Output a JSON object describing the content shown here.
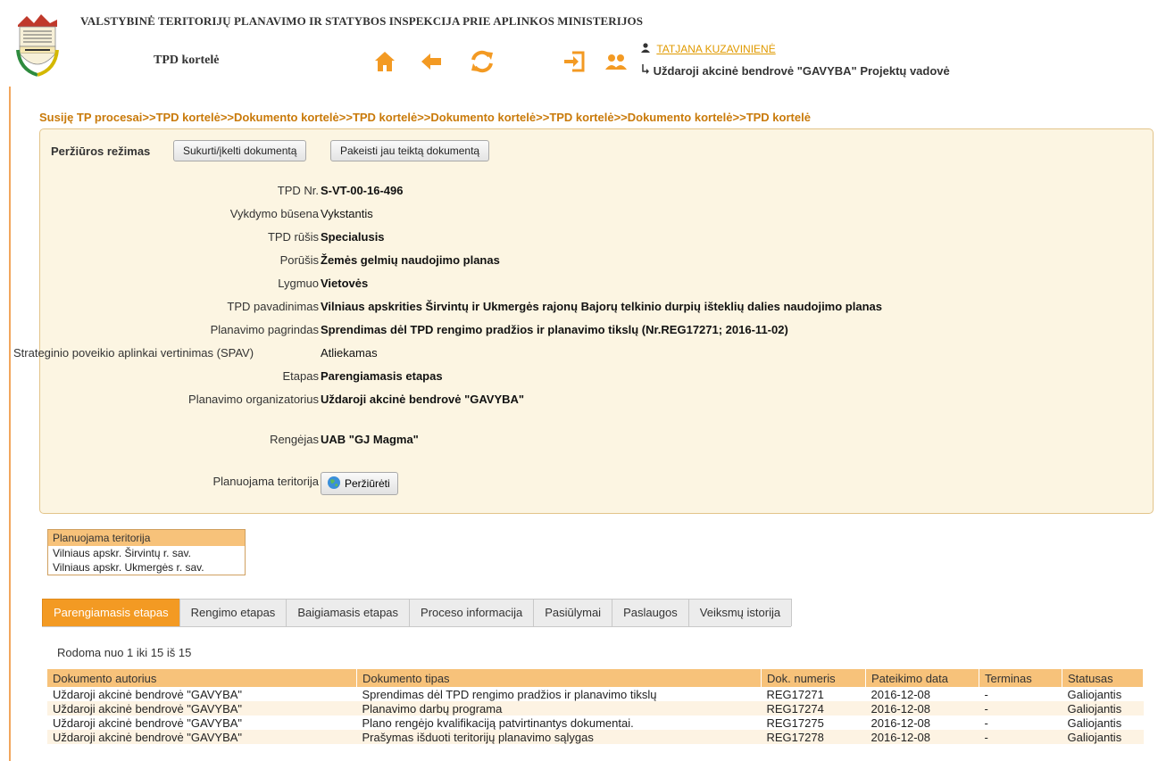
{
  "header": {
    "org_title": "VALSTYBINĖ TERITORIJŲ PLANAVIMO IR STATYBOS INSPEKCIJA PRIE APLINKOS MINISTERIJOS",
    "logo_text": "VALSTYBINĖ TERITORIJŲ PLANAVIMO IR STATYBOS INSPEKCIJA",
    "page_label": "TPD kortelė",
    "user_name": "TATJANA KUZAVINIENĖ",
    "user_role": "Uždaroji akcinė bendrovė \"GAVYBA\" Projektų vadovė",
    "accent_color": "#f39a23",
    "icons": [
      "home-icon",
      "back-arrow-icon",
      "refresh-icon",
      "logout-icon",
      "users-icon",
      "user-icon",
      "role-switch-icon"
    ]
  },
  "breadcrumb": [
    "Susiję TP procesai",
    "TPD kortelė",
    "Dokumento kortelė",
    "TPD kortelė",
    "Dokumento kortelė",
    "TPD kortelė",
    "Dokumento kortelė",
    "TPD kortelė"
  ],
  "breadcrumb_separator": ">>",
  "card": {
    "mode_label": "Peržiūros režimas",
    "create_button": "Sukurti/įkelti dokumentą",
    "replace_button": "Pakeisti jau teiktą dokumentą",
    "fields": [
      {
        "label": "TPD Nr.",
        "value": "S-VT-00-16-496",
        "bold": true
      },
      {
        "label": "Vykdymo būsena",
        "value": "Vykstantis",
        "bold": false
      },
      {
        "label": "TPD rūšis",
        "value": "Specialusis",
        "bold": true
      },
      {
        "label": "Porūšis",
        "value": "Žemės gelmių naudojimo planas",
        "bold": true
      },
      {
        "label": "Lygmuo",
        "value": "Vietovės",
        "bold": true
      },
      {
        "label": "TPD pavadinimas",
        "value": "Vilniaus apskrities Širvintų ir  Ukmergės  rajonų Bajorų telkinio durpių išteklių dalies naudojimo planas",
        "bold": true
      },
      {
        "label": "Planavimo pagrindas",
        "value": "Sprendimas dėl TPD rengimo pradžios ir planavimo tikslų (Nr.REG17271; 2016-11-02)",
        "bold": true
      },
      {
        "label": "Strateginio poveikio aplinkai vertinimas (SPAV)",
        "value": "Atliekamas",
        "bold": false
      },
      {
        "label": "Etapas",
        "value": "Parengiamasis etapas",
        "bold": true
      },
      {
        "label": "Planavimo organizatorius",
        "value": "Uždaroji akcinė bendrovė \"GAVYBA\"",
        "bold": true
      },
      {
        "label": "Rengėjas",
        "value": "UAB \"GJ Magma\"",
        "bold": true
      }
    ],
    "territory_label": "Planuojama teritorija",
    "view_button": "Peržiūrėti"
  },
  "territory_box": {
    "header": "Planuojama teritorija",
    "items": [
      "Vilniaus apskr. Širvintų r. sav.",
      "Vilniaus apskr. Ukmergės r. sav."
    ]
  },
  "tabs": [
    {
      "label": "Parengiamasis etapas",
      "active": true
    },
    {
      "label": "Rengimo etapas",
      "active": false
    },
    {
      "label": "Baigiamasis etapas",
      "active": false
    },
    {
      "label": "Proceso informacija",
      "active": false
    },
    {
      "label": "Pasiūlymai",
      "active": false
    },
    {
      "label": "Paslaugos",
      "active": false
    },
    {
      "label": "Veiksmų istorija",
      "active": false
    }
  ],
  "record_count": "Rodoma nuo 1 iki 15 iš 15",
  "table": {
    "headers": [
      "Dokumento autorius",
      "Dokumento tipas",
      "Dok. numeris",
      "Pateikimo data",
      "Terminas",
      "Statusas"
    ],
    "rows": [
      [
        "Uždaroji akcinė bendrovė \"GAVYBA\"",
        "Sprendimas dėl TPD rengimo pradžios ir planavimo tikslų",
        "REG17271",
        "2016-12-08",
        "-",
        "Galiojantis"
      ],
      [
        "Uždaroji akcinė bendrovė \"GAVYBA\"",
        "Planavimo darbų programa",
        "REG17274",
        "2016-12-08",
        "-",
        "Galiojantis"
      ],
      [
        "Uždaroji akcinė bendrovė \"GAVYBA\"",
        "Plano rengėjo kvalifikaciją patvirtinantys dokumentai.",
        "REG17275",
        "2016-12-08",
        "-",
        "Galiojantis"
      ],
      [
        "Uždaroji akcinė bendrovė \"GAVYBA\"",
        "Prašymas išduoti teritorijų planavimo sąlygas",
        "REG17278",
        "2016-12-08",
        "-",
        "Galiojantis"
      ]
    ]
  }
}
